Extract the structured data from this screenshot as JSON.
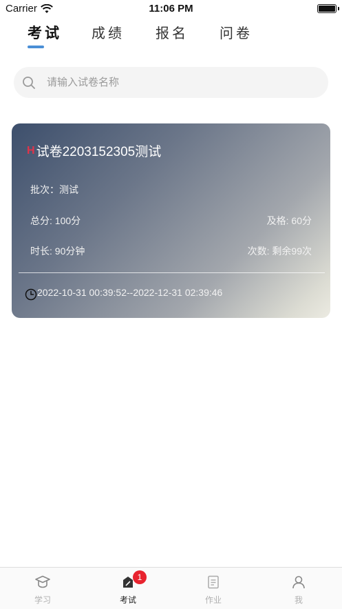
{
  "status_bar": {
    "carrier": "Carrier",
    "time": "11:06 PM"
  },
  "tabs": [
    {
      "label": "考试",
      "active": true
    },
    {
      "label": "成绩",
      "active": false
    },
    {
      "label": "报名",
      "active": false
    },
    {
      "label": "问卷",
      "active": false
    }
  ],
  "search": {
    "placeholder": "请输入试卷名称",
    "value": ""
  },
  "exam_card": {
    "badge": "H",
    "title": "试卷2203152305测试",
    "batch": "批次：测试",
    "total_score": "总分: 100分",
    "pass_score": "及格: 60分",
    "duration": "时长: 90分钟",
    "attempts": "次数: 剩余99次",
    "time_range": "2022-10-31 00:39:52--2022-12-31 02:39:46"
  },
  "bottom_nav": [
    {
      "label": "学习",
      "icon": "graduation-cap-icon",
      "active": false
    },
    {
      "label": "考试",
      "icon": "exam-pen-icon",
      "active": true,
      "badge": "1"
    },
    {
      "label": "作业",
      "icon": "document-icon",
      "active": false
    },
    {
      "label": "我",
      "icon": "user-icon",
      "active": false
    }
  ],
  "colors": {
    "tab_indicator": "#4a8fd6",
    "badge_red": "#e8232f",
    "h_badge": "#e0334a",
    "card_gradient_start": "#3d4f6c",
    "card_gradient_end": "#ecebe2"
  }
}
